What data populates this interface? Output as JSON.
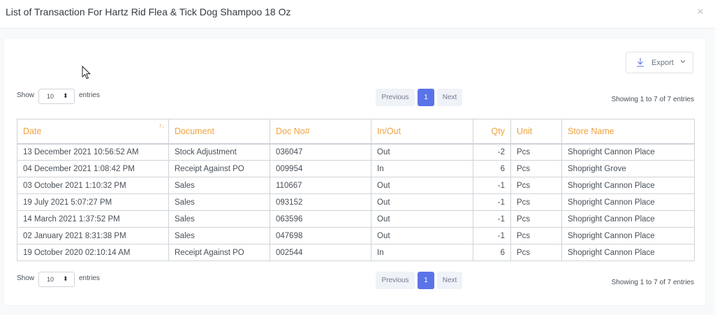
{
  "modal": {
    "title": "List of Transaction For Hartz Rid Flea & Tick Dog Shampoo 18 Oz",
    "close_symbol": "×"
  },
  "export": {
    "label": "Export",
    "icon": "download-icon"
  },
  "length": {
    "show": "Show",
    "value": "10",
    "entries": "entries"
  },
  "pagination": {
    "previous": "Previous",
    "current": "1",
    "next": "Next"
  },
  "info": "Showing 1 to 7 of 7 entries",
  "table": {
    "headers": {
      "date": "Date",
      "document": "Document",
      "doc_no": "Doc No#",
      "in_out": "In/Out",
      "qty": "Qty",
      "unit": "Unit",
      "store": "Store Name"
    },
    "sort_symbol": "↑↓",
    "rows": [
      {
        "date": "13 December 2021 10:56:52 AM",
        "document": "Stock Adjustment",
        "doc_no": "036047",
        "in_out": "Out",
        "qty": "-2",
        "unit": "Pcs",
        "store": "Shopright Cannon Place"
      },
      {
        "date": "04 December 2021 1:08:42 PM",
        "document": "Receipt Against PO",
        "doc_no": "009954",
        "in_out": "In",
        "qty": "6",
        "unit": "Pcs",
        "store": "Shopright Grove"
      },
      {
        "date": "03 October 2021 1:10:32 PM",
        "document": "Sales",
        "doc_no": "110667",
        "in_out": "Out",
        "qty": "-1",
        "unit": "Pcs",
        "store": "Shopright Cannon Place"
      },
      {
        "date": "19 July 2021 5:07:27 PM",
        "document": "Sales",
        "doc_no": "093152",
        "in_out": "Out",
        "qty": "-1",
        "unit": "Pcs",
        "store": "Shopright Cannon Place"
      },
      {
        "date": "14 March 2021 1:37:52 PM",
        "document": "Sales",
        "doc_no": "063596",
        "in_out": "Out",
        "qty": "-1",
        "unit": "Pcs",
        "store": "Shopright Cannon Place"
      },
      {
        "date": "02 January 2021 8:31:38 PM",
        "document": "Sales",
        "doc_no": "047698",
        "in_out": "Out",
        "qty": "-1",
        "unit": "Pcs",
        "store": "Shopright Cannon Place"
      },
      {
        "date": "19 October 2020 02:10:14 AM",
        "document": "Receipt Against PO",
        "doc_no": "002544",
        "in_out": "In",
        "qty": "6",
        "unit": "Pcs",
        "store": "Shopright Cannon Place"
      }
    ]
  },
  "colors": {
    "header_text": "#f1a23e",
    "primary": "#5b73e8",
    "pager_bg": "#eff2f7"
  }
}
